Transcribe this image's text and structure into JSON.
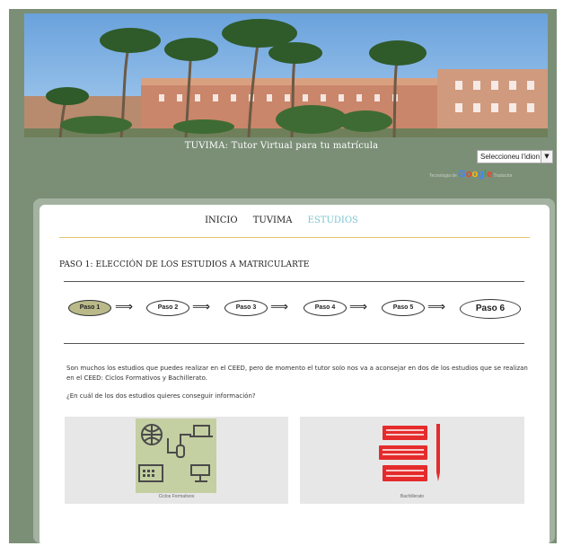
{
  "header": {
    "site_title": "TUVIMA: Tutor Virtual para tu matrícula"
  },
  "language": {
    "select_value": "Seleccioneu l'idion",
    "powered_prefix": "Tecnologia de",
    "powered_suffix": "Traductor"
  },
  "nav": {
    "items": [
      "INICIO",
      "TUVIMA",
      "ESTUDIOS"
    ],
    "active_index": 2,
    "active_color": "#7ec4cf"
  },
  "step": {
    "title": "PASO 1: ELECCIÓN DE LOS ESTUDIOS A MATRICULARTE"
  },
  "steps": {
    "labels": [
      "Paso 1",
      "Paso 2",
      "Paso 3",
      "Paso 4",
      "Paso 5",
      "Paso 6"
    ],
    "current": "Paso 1"
  },
  "content": {
    "paragraph": "Son muchos los estudios que puedes realizar en el CEED, pero de momento el tutor solo nos va a aconsejar en dos de los estudios que se realizan en el CEED: Ciclos Formativos y Bachillerato.",
    "question": "¿En cuál de los dos estudios quieres conseguir información?"
  },
  "options": {
    "ciclos": {
      "caption": "Ciclos Formativos",
      "icon": "computer-network-icon"
    },
    "bachillerato": {
      "caption": "Bachillerato",
      "icon": "books-pencil-icon"
    }
  },
  "colors": {
    "background": "#7b8f77",
    "accent_line": "#e0c56a",
    "active_step": "#b9b98a",
    "ciclos_tile": "#c4cfa2",
    "bachillerato_red": "#e52b2b"
  }
}
